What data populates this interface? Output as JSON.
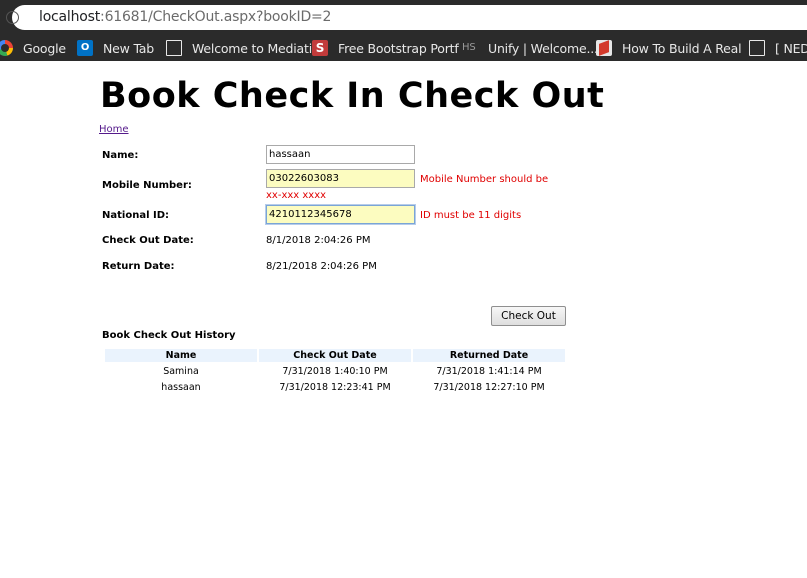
{
  "browser": {
    "url_host": "localhost",
    "url_rest": ":61681/CheckOut.aspx?bookID=2",
    "bookmarks": [
      {
        "label": "Google",
        "icon": "google-icon"
      },
      {
        "label": "New Tab",
        "icon": "outlook-icon"
      },
      {
        "label": "Welcome to Mediati",
        "icon": "document-icon"
      },
      {
        "label": "Free Bootstrap Portf",
        "icon": "s-icon"
      },
      {
        "label": "Unify | Welcome...",
        "icon": "hs-icon"
      },
      {
        "label": "How To Build A Real",
        "icon": "stackoverflow-icon"
      },
      {
        "label": "[ NEDU",
        "icon": "document-icon"
      }
    ]
  },
  "page": {
    "title": "Book Check In Check Out",
    "home_link": "Home",
    "form": {
      "name_label": "Name:",
      "name_value": "hassaan",
      "mobile_label": "Mobile Number:",
      "mobile_value": "03022603083",
      "mobile_error_line1": "Mobile Number should be",
      "mobile_error_line2": "xx-xxx xxxx",
      "nid_label": "National ID:",
      "nid_value": "4210112345678",
      "nid_error": "ID must be 11 digits",
      "checkout_label": "Check Out Date:",
      "checkout_value": "8/1/2018 2:04:26 PM",
      "return_label": "Return Date:",
      "return_value": "8/21/2018 2:04:26 PM",
      "checkout_button": "Check Out"
    },
    "history": {
      "title": "Book Check Out History",
      "columns": [
        "Name",
        "Check Out Date",
        "Returned Date"
      ],
      "rows": [
        [
          "Samina",
          "7/31/2018 1:40:10 PM",
          "7/31/2018 1:41:14 PM"
        ],
        [
          "hassaan",
          "7/31/2018 12:23:41 PM",
          "7/31/2018 12:27:10 PM"
        ]
      ]
    }
  }
}
